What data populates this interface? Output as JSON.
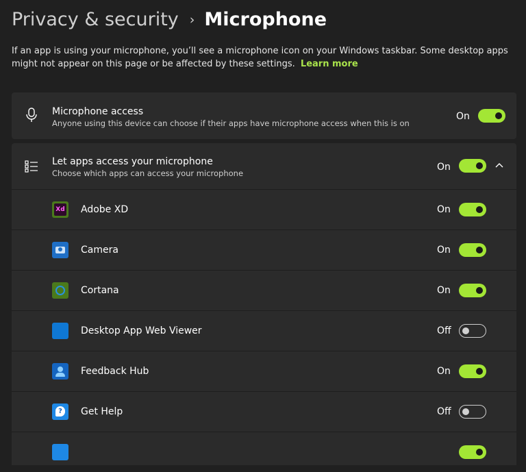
{
  "breadcrumb": {
    "parent": "Privacy & security",
    "separator": "›",
    "current": "Microphone"
  },
  "description": {
    "text": "If an app is using your microphone, you’ll see a microphone icon on your Windows taskbar. Some desktop apps might not appear on this page or be affected by these settings.",
    "link": "Learn more"
  },
  "microphone_access": {
    "title": "Microphone access",
    "subtitle": "Anyone using this device can choose if their apps have microphone access when this is on",
    "state": "On",
    "enabled": true
  },
  "apps_access": {
    "title": "Let apps access your microphone",
    "subtitle": "Choose which apps can access your microphone",
    "state": "On",
    "enabled": true,
    "expanded": true
  },
  "apps": [
    {
      "name": "Adobe XD",
      "state": "On",
      "enabled": true,
      "icon": "adobe-xd-icon"
    },
    {
      "name": "Camera",
      "state": "On",
      "enabled": true,
      "icon": "camera-icon"
    },
    {
      "name": "Cortana",
      "state": "On",
      "enabled": true,
      "icon": "cortana-icon"
    },
    {
      "name": "Desktop App Web Viewer",
      "state": "Off",
      "enabled": false,
      "icon": "desktop-app-web-viewer-icon"
    },
    {
      "name": "Feedback Hub",
      "state": "On",
      "enabled": true,
      "icon": "feedback-hub-icon"
    },
    {
      "name": "Get Help",
      "state": "Off",
      "enabled": false,
      "icon": "get-help-icon"
    },
    {
      "name": "",
      "state": "",
      "enabled": true,
      "icon": "app-icon"
    }
  ],
  "colors": {
    "background": "#202020",
    "card": "#2b2b2b",
    "accent": "#a3e635",
    "link": "#a9e34b"
  }
}
